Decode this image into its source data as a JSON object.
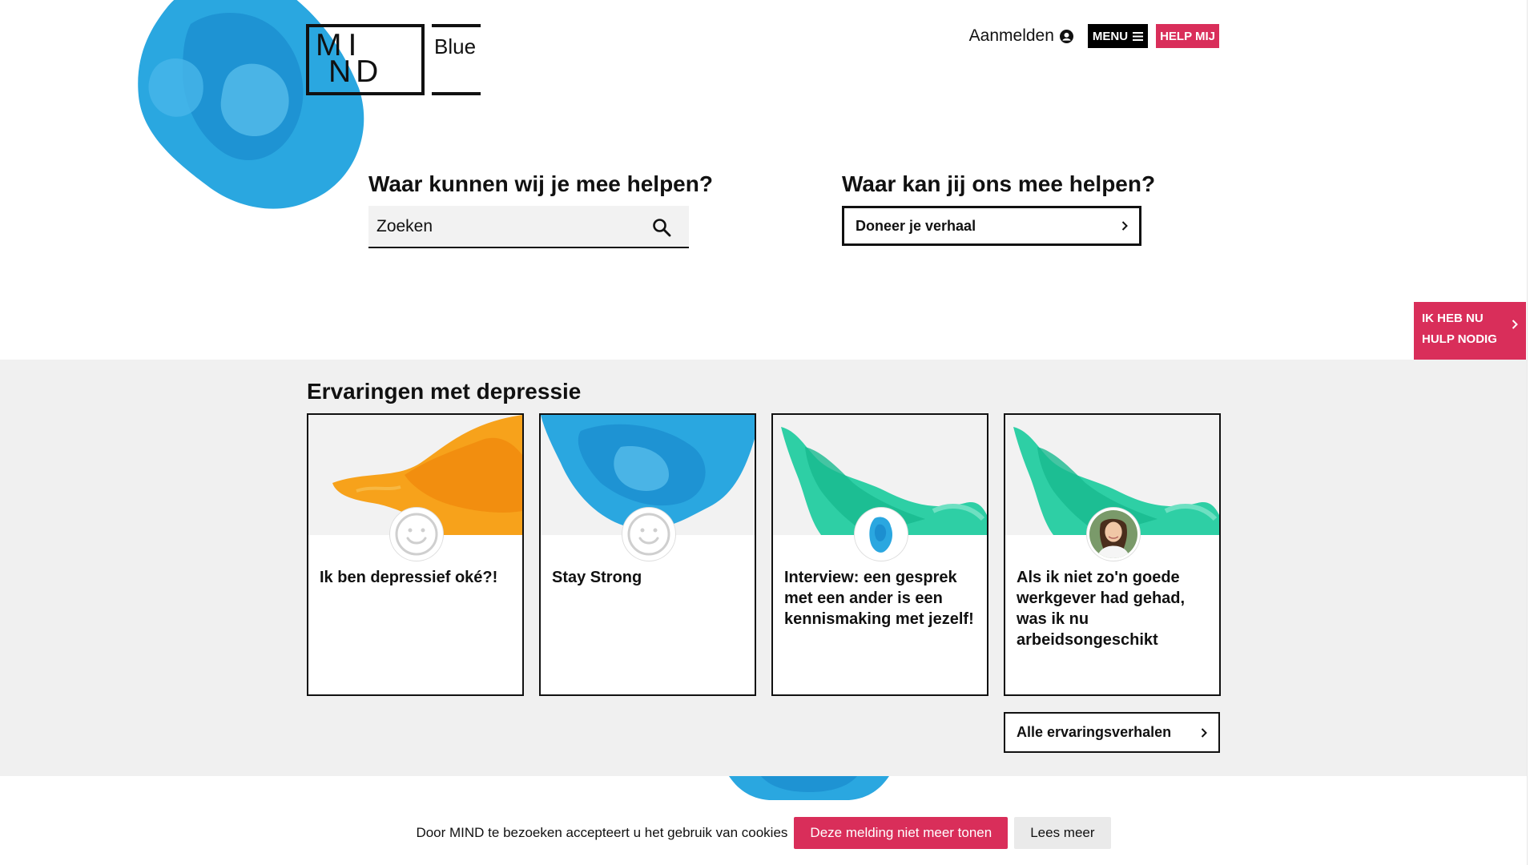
{
  "header": {
    "logo": "MIND Blue",
    "signin_label": "Aanmelden",
    "menu_label": "MENU",
    "help_label": "HELP MIJ"
  },
  "search_section": {
    "title": "Waar kunnen wij je mee helpen?",
    "placeholder": "Zoeken"
  },
  "donate_section": {
    "title": "Waar kan jij ons mee helpen?",
    "button_label": "Doneer je verhaal"
  },
  "side_help": {
    "line1": "IK HEB NU",
    "line2": "HULP NODIG"
  },
  "experiences": {
    "title": "Ervaringen met depressie",
    "cards": [
      {
        "title": "Ik ben depressief oké?!",
        "image": "orange-ink",
        "avatar": "smiley-icon"
      },
      {
        "title": "Stay Strong",
        "image": "blue-ink",
        "avatar": "smiley-icon"
      },
      {
        "title": "Interview: een gesprek met een ander is een kennismaking met jezelf!",
        "image": "green-ink",
        "avatar": "blue-ink-avatar"
      },
      {
        "title": "Als ik niet zo'n goede werkgever had gehad, was ik nu arbeidsongeschikt",
        "image": "green-ink",
        "avatar": "person-photo"
      }
    ],
    "all_label": "Alle ervaringsverhalen"
  },
  "cookie": {
    "text": "Door MIND te bezoeken accepteert u het gebruik van cookies",
    "accept_label": "Deze melding niet meer tonen",
    "more_label": "Lees meer"
  },
  "colors": {
    "accent": "#d92e5a",
    "ink_blue": "#2aa7e0",
    "ink_orange": "#f7a21b",
    "ink_green": "#2ecfa5",
    "section_bg": "#f0f0f0"
  }
}
